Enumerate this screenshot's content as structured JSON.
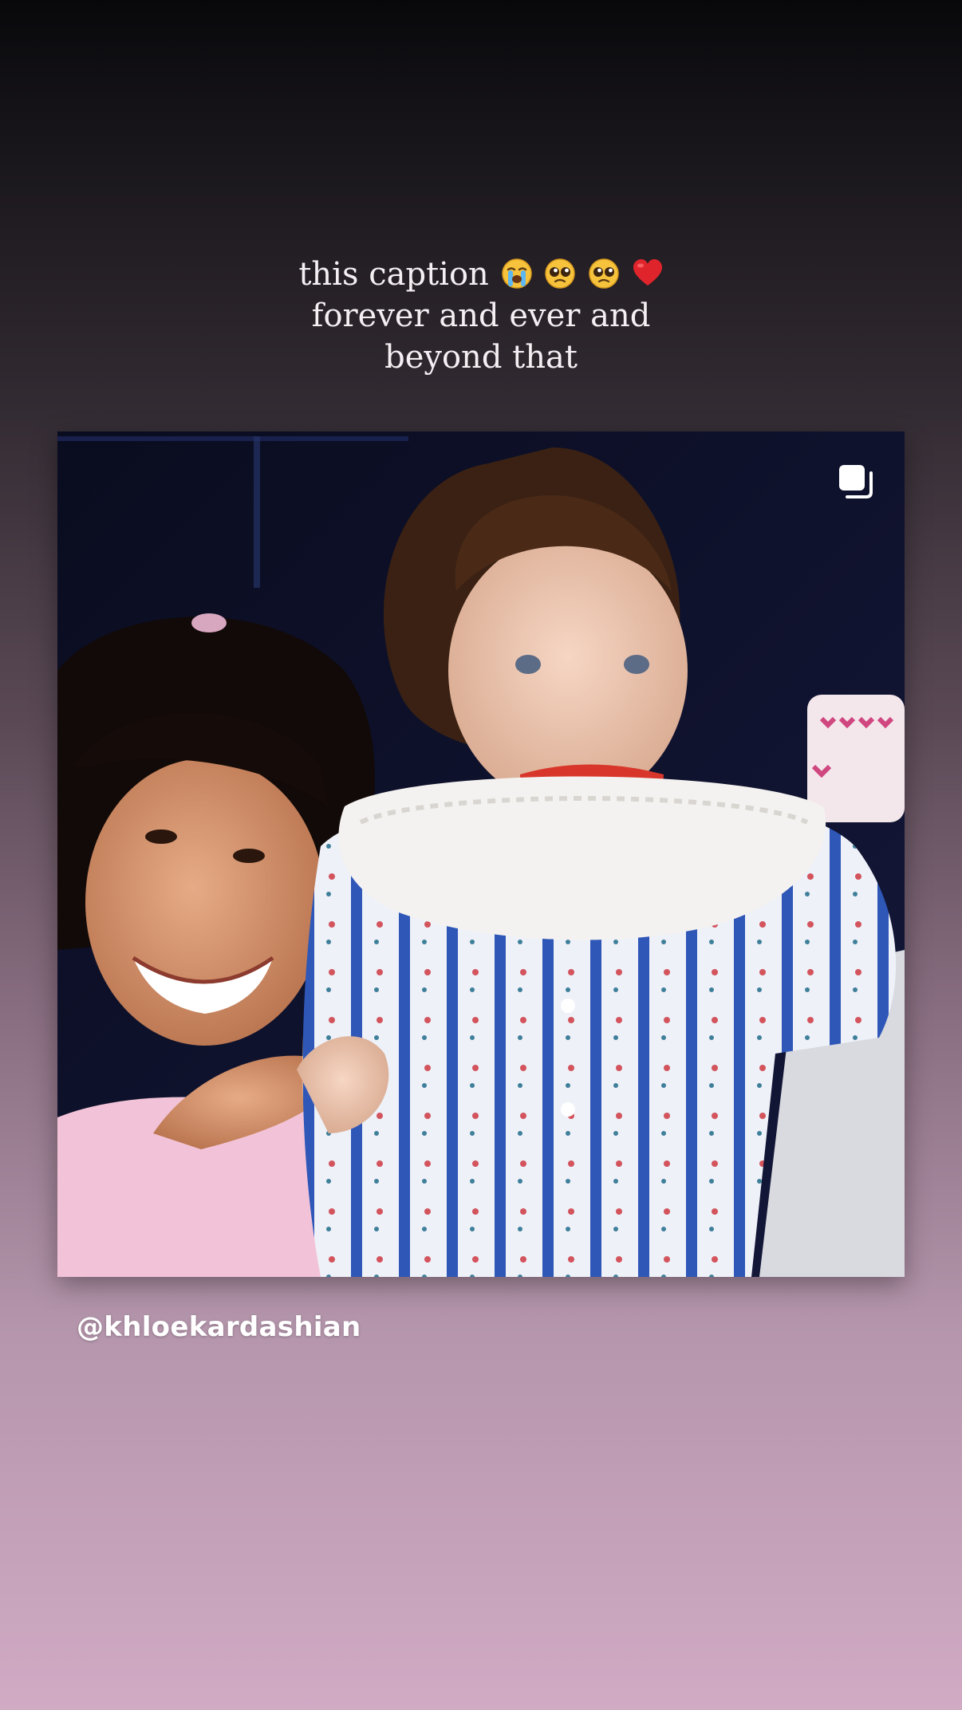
{
  "story": {
    "caption": {
      "line1": "this caption",
      "line2": "forever and ever and",
      "line3": "beyond that",
      "emojis": [
        "loudly-crying-face-icon",
        "pleading-face-icon",
        "pleading-face-icon",
        "red-heart-icon"
      ]
    },
    "post": {
      "multi_image_icon": "carousel-icon",
      "mention": "@khloekardashian"
    },
    "colors": {
      "gradient_top": "#08080b",
      "gradient_bottom": "#d1aac4",
      "text": "#ffffff"
    }
  }
}
